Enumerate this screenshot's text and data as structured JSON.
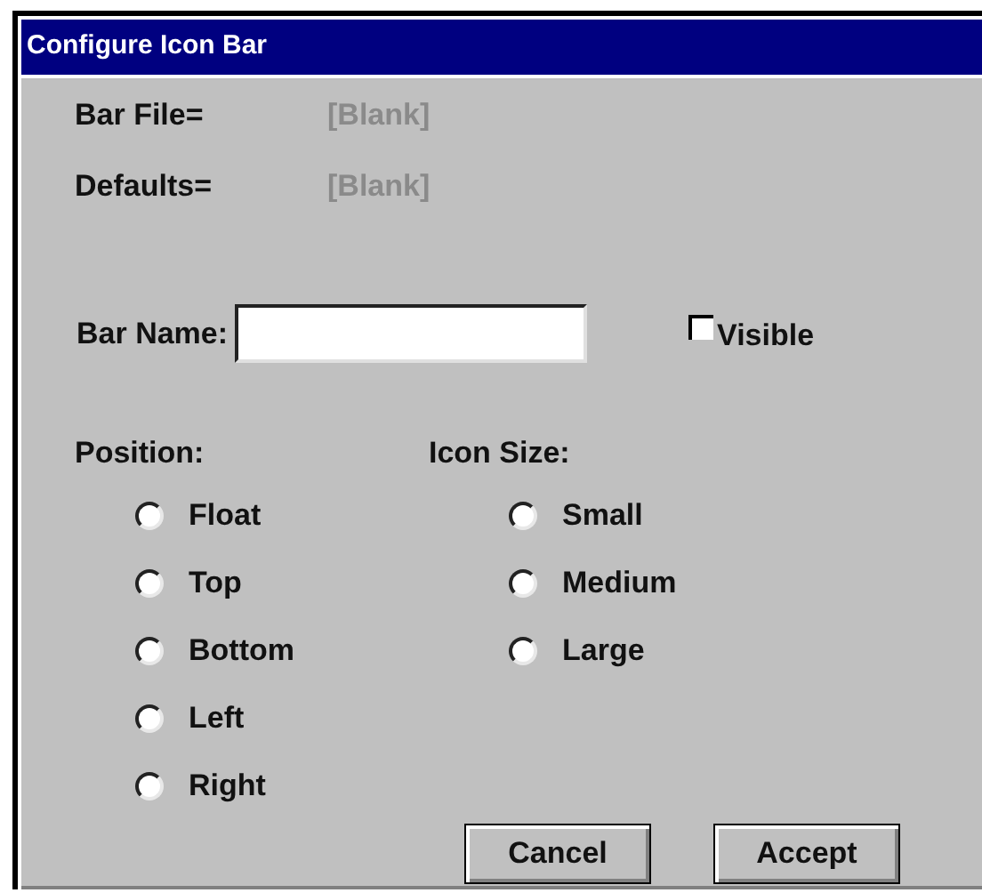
{
  "window": {
    "title": "Configure Icon Bar"
  },
  "info": [
    {
      "label": "Bar File=",
      "value": "[Blank]"
    },
    {
      "label": "Defaults=",
      "value": "[Blank]"
    }
  ],
  "bar_name": {
    "label": "Bar Name:"
  },
  "visible": {
    "label": "Visible",
    "checked": false
  },
  "groups": [
    {
      "label": "Position:",
      "options": [
        {
          "label": "Float",
          "selected": false
        },
        {
          "label": "Top",
          "selected": false
        },
        {
          "label": "Bottom",
          "selected": false
        },
        {
          "label": "Left",
          "selected": false
        },
        {
          "label": "Right",
          "selected": false
        }
      ]
    },
    {
      "label": "Icon Size:",
      "options": [
        {
          "label": "Small",
          "selected": false
        },
        {
          "label": "Medium",
          "selected": false
        },
        {
          "label": "Large",
          "selected": false
        }
      ]
    }
  ],
  "buttons": [
    "Cancel",
    "Accept"
  ]
}
